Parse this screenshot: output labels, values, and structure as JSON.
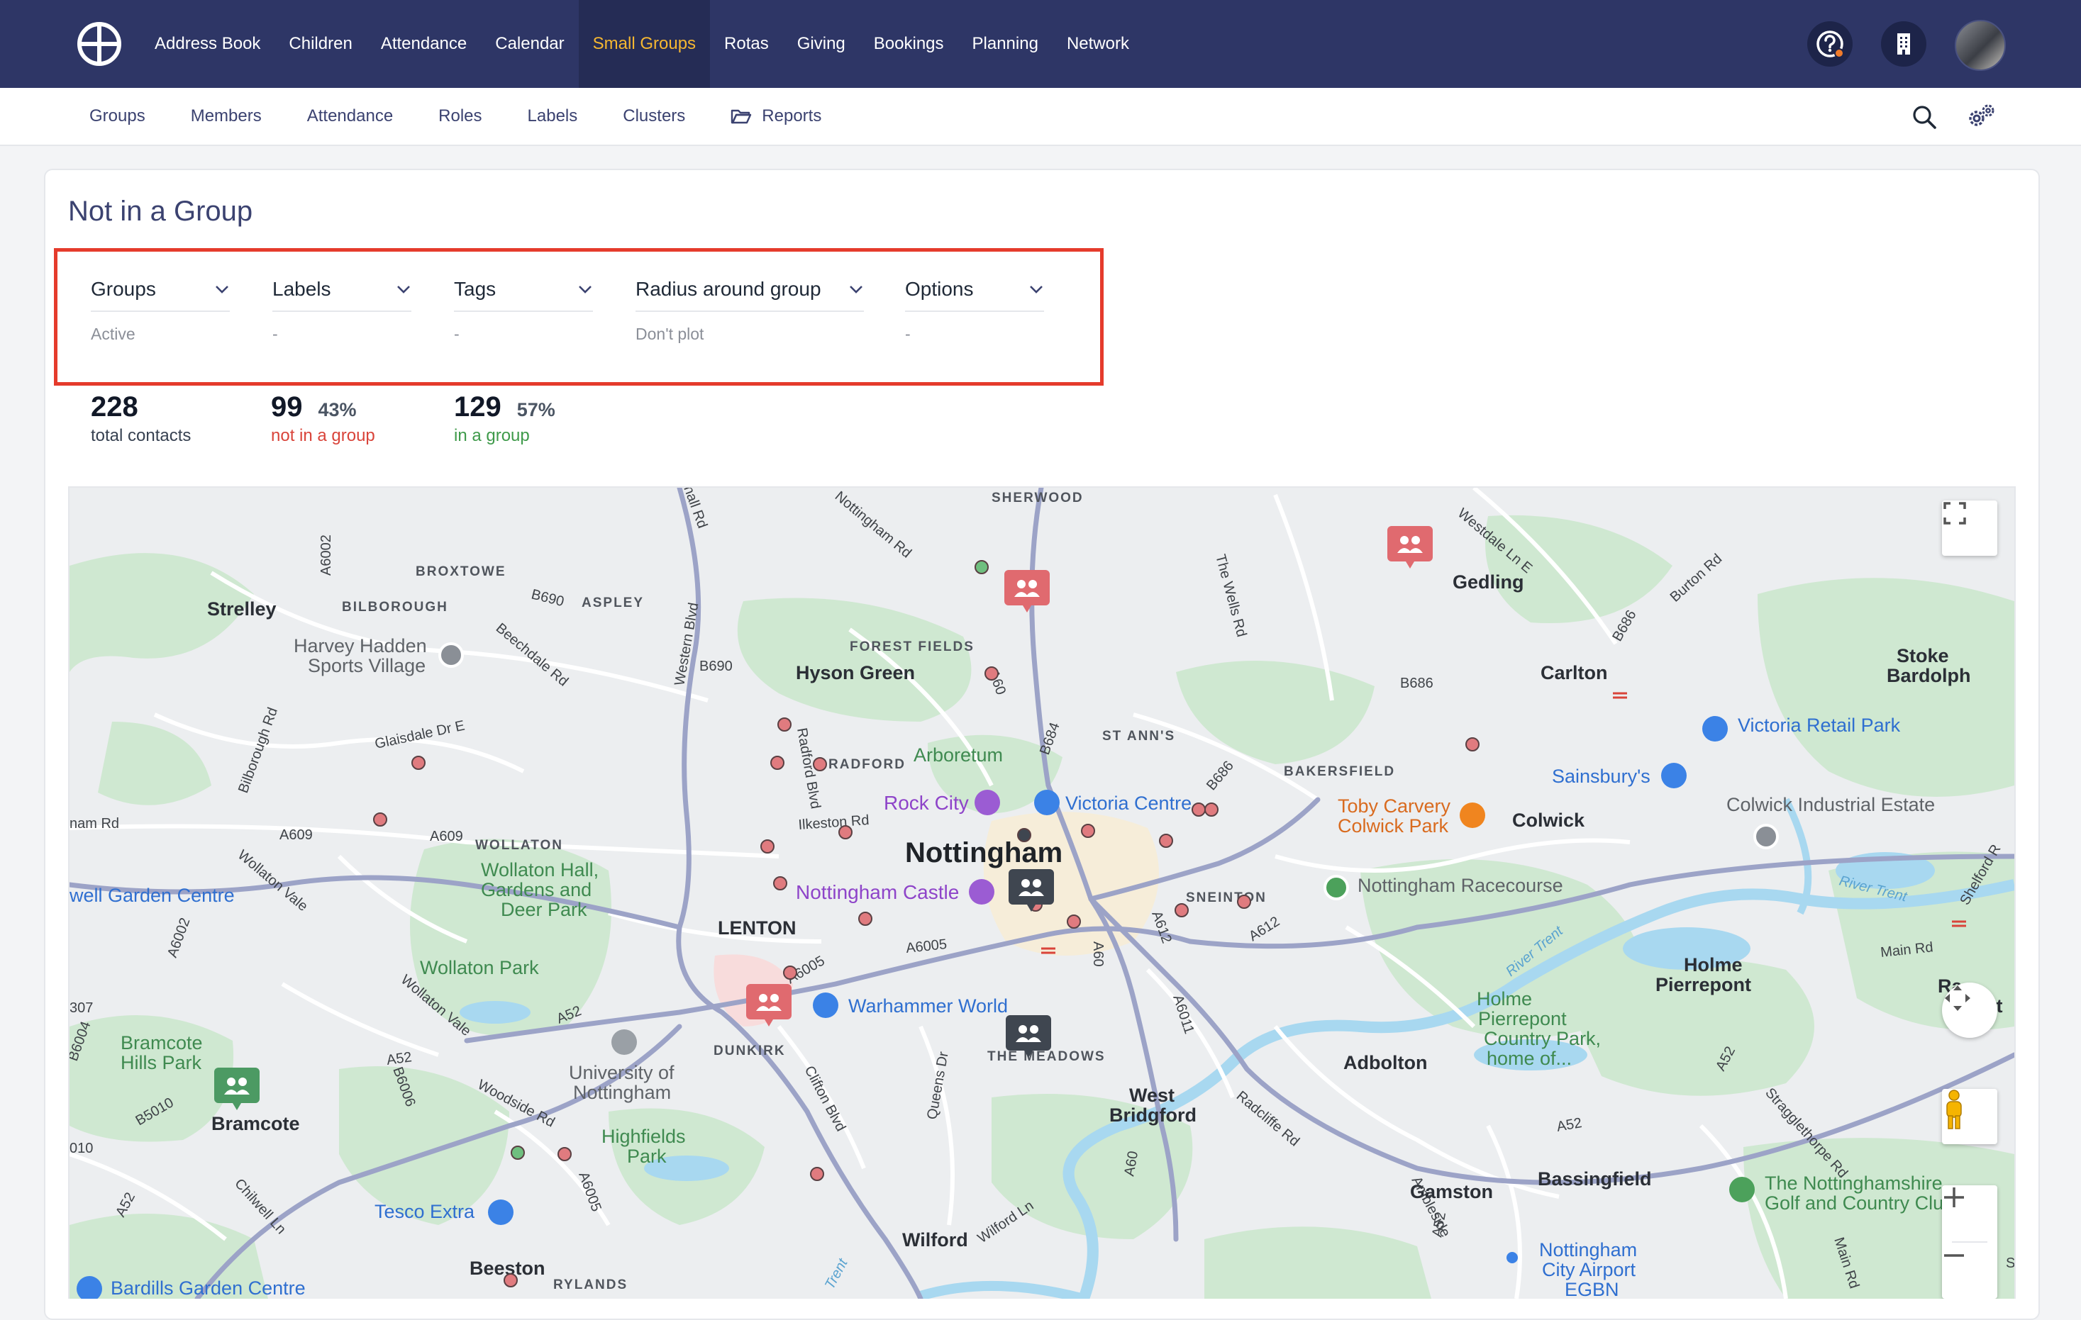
{
  "topnav": {
    "items": [
      "Address Book",
      "Children",
      "Attendance",
      "Calendar",
      "Small Groups",
      "Rotas",
      "Giving",
      "Bookings",
      "Planning",
      "Network"
    ],
    "active": "Small Groups",
    "icons": [
      "help-icon",
      "building-icon"
    ]
  },
  "subnav": {
    "items": [
      "Groups",
      "Members",
      "Attendance",
      "Roles",
      "Labels",
      "Clusters",
      "Reports"
    ]
  },
  "page": {
    "title": "Not in a Group"
  },
  "filters": [
    {
      "label": "Groups",
      "value": "Active"
    },
    {
      "label": "Labels",
      "value": "-"
    },
    {
      "label": "Tags",
      "value": "-"
    },
    {
      "label": "Radius around group",
      "value": "Don't plot"
    },
    {
      "label": "Options",
      "value": "-"
    }
  ],
  "stats": {
    "total": {
      "number": "228",
      "caption": "total contacts"
    },
    "not_in_group": {
      "number": "99",
      "percent": "43%",
      "caption": "not in a group"
    },
    "in_group": {
      "number": "129",
      "percent": "57%",
      "caption": "in a group"
    }
  },
  "map": {
    "labels": [
      {
        "text": "SHERWOOD",
        "cls": "dist"
      },
      {
        "text": "BROXTOWE",
        "cls": "dist"
      },
      {
        "text": "BILBOROUGH",
        "cls": "dist"
      },
      {
        "text": "ASPLEY",
        "cls": "dist"
      },
      {
        "text": "FOREST FIELDS",
        "cls": "dist"
      },
      {
        "text": "RADFORD",
        "cls": "dist"
      },
      {
        "text": "ST ANN'S",
        "cls": "dist"
      },
      {
        "text": "BAKERSFIELD",
        "cls": "dist"
      },
      {
        "text": "SNEINTON",
        "cls": "dist"
      },
      {
        "text": "WOLLATON",
        "cls": "dist"
      },
      {
        "text": "LENTON",
        "cls": "dist"
      },
      {
        "text": "DUNKIRK",
        "cls": "dist"
      },
      {
        "text": "THE MEADOWS",
        "cls": "dist"
      },
      {
        "text": "RYLANDS",
        "cls": "dist"
      },
      {
        "text": "Strelley",
        "cls": "town"
      },
      {
        "text": "Gedling",
        "cls": "town"
      },
      {
        "text": "Carlton",
        "cls": "town"
      },
      {
        "text": "Stoke",
        "cls": "town"
      },
      {
        "text": "Bardolph",
        "cls": "town"
      },
      {
        "text": "Hyson Green",
        "cls": "town"
      },
      {
        "text": "Nottingham",
        "cls": "city"
      },
      {
        "text": "Colwick",
        "cls": "town"
      },
      {
        "text": "Holme",
        "cls": "town"
      },
      {
        "text": "Pierrepont",
        "cls": "town"
      },
      {
        "text": "Adbolton",
        "cls": "town"
      },
      {
        "text": "West",
        "cls": "town"
      },
      {
        "text": "Bridgford",
        "cls": "town"
      },
      {
        "text": "Bramcote",
        "cls": "town"
      },
      {
        "text": "Gamston",
        "cls": "town"
      },
      {
        "text": "Bassingfield",
        "cls": "town"
      },
      {
        "text": "Wilford",
        "cls": "town"
      },
      {
        "text": "Beeston",
        "cls": "town"
      },
      {
        "text": "Harvey Hadden",
        "cls": "poi-grey"
      },
      {
        "text": "Sports Village",
        "cls": "poi-grey"
      },
      {
        "text": "Wollaton Hall,",
        "cls": "poi-green"
      },
      {
        "text": "Gardens and",
        "cls": "poi-green"
      },
      {
        "text": "Deer Park",
        "cls": "poi-green"
      },
      {
        "text": "Wollaton Park",
        "cls": "poi-green"
      },
      {
        "text": "Arboretum",
        "cls": "poi-green"
      },
      {
        "text": "Rock City",
        "cls": "poi-purple"
      },
      {
        "text": "Victoria Centre",
        "cls": "poi-blue"
      },
      {
        "text": "Nottingham Castle",
        "cls": "poi-purple"
      },
      {
        "text": "Toby Carvery",
        "cls": "poi-orange"
      },
      {
        "text": "Colwick Park",
        "cls": "poi-orange"
      },
      {
        "text": "Sainsbury's",
        "cls": "poi-blue"
      },
      {
        "text": "Victoria Retail Park",
        "cls": "poi-blue"
      },
      {
        "text": "Colwick Industrial Estate",
        "cls": "poi-grey"
      },
      {
        "text": "Nottingham Racecourse",
        "cls": "poi-grey"
      },
      {
        "text": "Holme",
        "cls": "poi-green"
      },
      {
        "text": "Pierrepont",
        "cls": "poi-green"
      },
      {
        "text": "Country Park,",
        "cls": "poi-green"
      },
      {
        "text": "home of...",
        "cls": "poi-green"
      },
      {
        "text": "Warhammer World",
        "cls": "poi-blue"
      },
      {
        "text": "University of",
        "cls": "poi-grey"
      },
      {
        "text": "Nottingham",
        "cls": "poi-grey"
      },
      {
        "text": "Highfields",
        "cls": "poi-green"
      },
      {
        "text": "Park",
        "cls": "poi-green"
      },
      {
        "text": "Bramcote",
        "cls": "poi-green"
      },
      {
        "text": "Hills Park",
        "cls": "poi-green"
      },
      {
        "text": "well Garden Centre",
        "cls": "poi-blue"
      },
      {
        "text": "Tesco Extra",
        "cls": "poi-blue"
      },
      {
        "text": "Bardills Garden Centre",
        "cls": "poi-blue"
      },
      {
        "text": "The Nottinghamshire",
        "cls": "poi-green"
      },
      {
        "text": "Golf and Country Clu",
        "cls": "poi-green"
      },
      {
        "text": "Nottingham",
        "cls": "poi-blue"
      },
      {
        "text": "City Airport",
        "cls": "poi-blue"
      },
      {
        "text": "EGBN",
        "cls": "poi-blue"
      },
      {
        "text": "Ra",
        "cls": "town"
      },
      {
        "text": "nt",
        "cls": "town"
      },
      {
        "text": "A6002",
        "cls": "road"
      },
      {
        "text": "B690",
        "cls": "road"
      },
      {
        "text": "Beechdale Rd",
        "cls": "road"
      },
      {
        "text": "Western Blvd",
        "cls": "road"
      },
      {
        "text": "B690",
        "cls": "road"
      },
      {
        "text": "Nottingham Rd",
        "cls": "road"
      },
      {
        "text": "The Wells Rd",
        "cls": "road"
      },
      {
        "text": "Westdale Ln E",
        "cls": "road"
      },
      {
        "text": "Burton Rd",
        "cls": "road"
      },
      {
        "text": "B686",
        "cls": "road"
      },
      {
        "text": "B686",
        "cls": "road"
      },
      {
        "text": "Bilborough Rd",
        "cls": "road"
      },
      {
        "text": "Glaisdale Dr E",
        "cls": "road"
      },
      {
        "text": "Radford Blvd",
        "cls": "road"
      },
      {
        "text": "A60",
        "cls": "road"
      },
      {
        "text": "B684",
        "cls": "road"
      },
      {
        "text": "B686",
        "cls": "road"
      },
      {
        "text": "A609",
        "cls": "road"
      },
      {
        "text": "A609",
        "cls": "road"
      },
      {
        "text": "Ilkeston Rd",
        "cls": "road"
      },
      {
        "text": "Wollaton Vale",
        "cls": "road"
      },
      {
        "text": "A6002",
        "cls": "road"
      },
      {
        "text": "A6005",
        "cls": "road"
      },
      {
        "text": "A6005",
        "cls": "road"
      },
      {
        "text": "A60",
        "cls": "road"
      },
      {
        "text": "A612",
        "cls": "road"
      },
      {
        "text": "A612",
        "cls": "road"
      },
      {
        "text": "A6011",
        "cls": "road"
      },
      {
        "text": "River Trent",
        "cls": "river"
      },
      {
        "text": "River Trent",
        "cls": "river"
      },
      {
        "text": "Main Rd",
        "cls": "road"
      },
      {
        "text": "Shelford R",
        "cls": "road"
      },
      {
        "text": "Wollaton Vale",
        "cls": "road"
      },
      {
        "text": "A52",
        "cls": "road"
      },
      {
        "text": "A52",
        "cls": "road"
      },
      {
        "text": "B6006",
        "cls": "road"
      },
      {
        "text": "Woodside Rd",
        "cls": "road"
      },
      {
        "text": "B6004",
        "cls": "road"
      },
      {
        "text": "B5010",
        "cls": "road"
      },
      {
        "text": "Clifton Blvd",
        "cls": "road"
      },
      {
        "text": "Queens Dr",
        "cls": "road"
      },
      {
        "text": "Radcliffe Rd",
        "cls": "road"
      },
      {
        "text": "A52",
        "cls": "road"
      },
      {
        "text": "A52",
        "cls": "road"
      },
      {
        "text": "Stragglethorpe Rd",
        "cls": "road"
      },
      {
        "text": "A6005",
        "cls": "road"
      },
      {
        "text": "Chilwell Ln",
        "cls": "road"
      },
      {
        "text": "A52",
        "cls": "road"
      },
      {
        "text": "Wilford Ln",
        "cls": "road"
      },
      {
        "text": "A60",
        "cls": "road"
      },
      {
        "text": "Ambleside",
        "cls": "road"
      },
      {
        "text": "A52",
        "cls": "road"
      },
      {
        "text": "Main Rd",
        "cls": "road"
      },
      {
        "text": "nam Rd",
        "cls": "road"
      },
      {
        "text": "nall Rd",
        "cls": "road"
      },
      {
        "text": "d",
        "cls": "road"
      },
      {
        "text": "010",
        "cls": "road"
      },
      {
        "text": "307",
        "cls": "road"
      },
      {
        "text": "Trent",
        "cls": "river"
      },
      {
        "text": "S",
        "cls": "road"
      }
    ],
    "markers": {
      "group_pins": 6
    },
    "colors": {
      "contact_dot": "#e07b7f",
      "group_pin_red": "#e06a6f",
      "group_pin_dark": "#3f4650",
      "group_pin_green": "#4c9a63",
      "park": "#cfe9d0",
      "water": "#a8d9f0",
      "road": "#9ca3c7"
    }
  }
}
